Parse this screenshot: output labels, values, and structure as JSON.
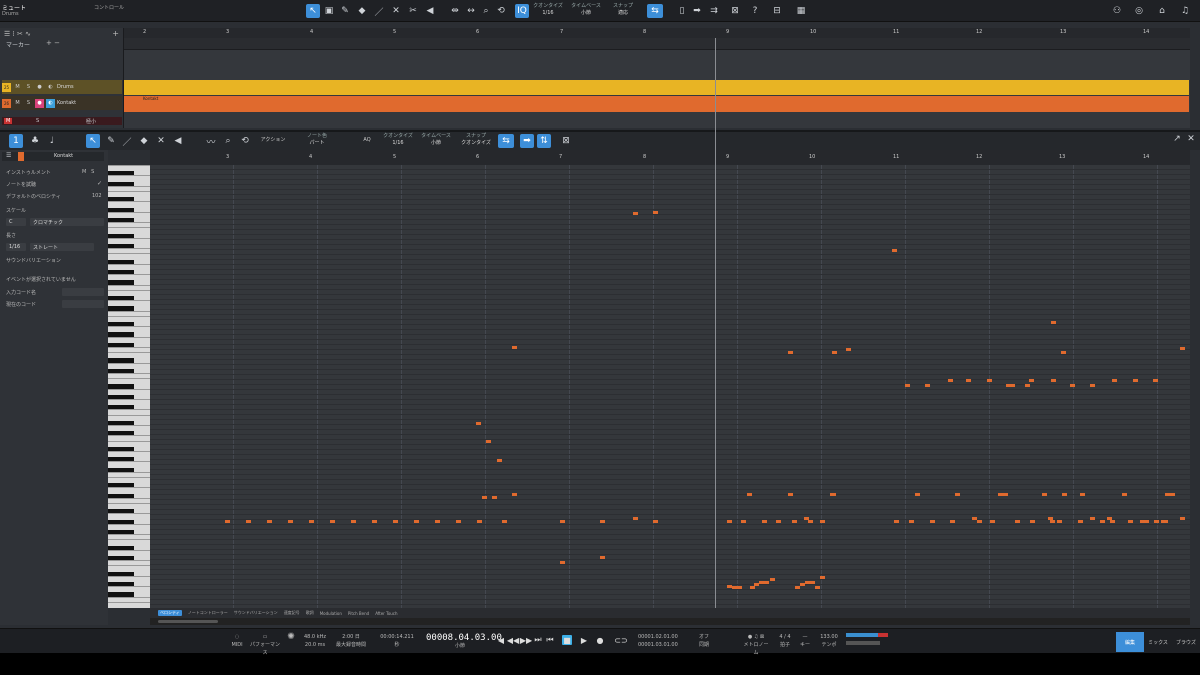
{
  "song": {
    "title": "ミュート",
    "subtitle": "Drums",
    "control_label": "コントロール"
  },
  "toolbar": {
    "quantize": {
      "label": "クオンタイズ",
      "value": "1/16"
    },
    "timebase": {
      "label": "タイムベース",
      "value": "小節"
    },
    "snap": {
      "label": "スナップ",
      "value": "適応"
    }
  },
  "arrange": {
    "marker_label": "マーカー",
    "bars": [
      "2",
      "3",
      "4",
      "5",
      "6",
      "7",
      "8",
      "9",
      "10",
      "11",
      "12",
      "13",
      "14"
    ],
    "tracks": [
      {
        "num": "25",
        "name": "Drums",
        "color": "#e8b424"
      },
      {
        "num": "26",
        "name": "Kontakt",
        "color": "#e06a2e"
      }
    ],
    "kontakt_clip": "Kontakt",
    "small_label": "極小"
  },
  "editor": {
    "instrument": "Kontakt",
    "inspector": {
      "instrument_label": "インストゥルメント",
      "note_preview": "ノートを試聴",
      "default_velocity_label": "デフォルトのベロシティ",
      "default_velocity": "102",
      "scale_label": "スケール",
      "scale_root": "C",
      "scale_type": "クロマチック",
      "length_label": "長さ",
      "length_value": "1/16",
      "length_mode": "ストレート",
      "sound_variation": "サウンドバリエーション",
      "no_event": "イベントが選択されていません",
      "input_chord": "入力コード名",
      "current_chord": "現在のコード"
    },
    "tools": {
      "action": "アクション",
      "note_color_label": "ノート色",
      "note_color": "パート",
      "aq": "AQ",
      "quantize_label": "クオンタイズ",
      "quantize": "1/16",
      "timebase_label": "タイムベース",
      "timebase": "小節",
      "snap_label": "スナップ",
      "snap": "クオンタイズ"
    },
    "bars": [
      "3",
      "4",
      "5",
      "6",
      "7",
      "8",
      "9",
      "10",
      "11",
      "12",
      "13",
      "14"
    ],
    "lanes": [
      "ベロシティ",
      "ノートコントローラー",
      "サウンドバリエーション",
      "速度記号",
      "歌詞",
      "Modulation",
      "Pitch Bend",
      "After Touch"
    ]
  },
  "transport": {
    "midi": "MIDI",
    "performance": "パフォーマンス",
    "sample_rate": "48.0 kHz",
    "latency": "20.0 ms",
    "days": "2:00 日",
    "max_rec": "最大録音時間",
    "time": "00:00:14.211",
    "time_unit": "秒",
    "position": "00008.04.03.00",
    "position_unit": "小節",
    "loop_start": "00001.02.01.00",
    "loop_end": "00001.03.01.00",
    "off": "オフ",
    "sync": "同期",
    "metronome": "メトロノーム",
    "signature": "4 / 4",
    "signature_label": "拍子",
    "key_label": "キー",
    "tempo": "133.00",
    "tempo_label": "テンポ",
    "views": [
      "編集",
      "ミックス",
      "ブラウズ"
    ]
  }
}
